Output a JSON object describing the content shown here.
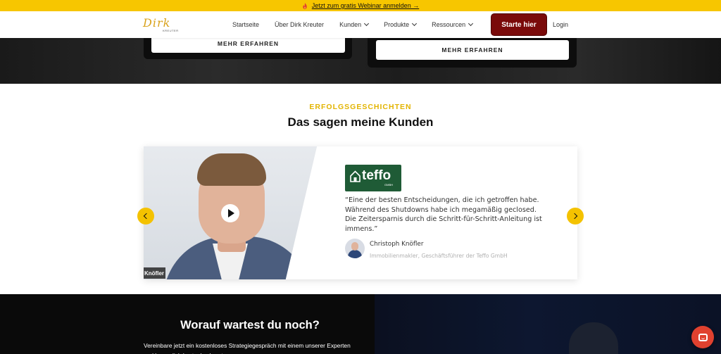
{
  "announcement": {
    "text": "Jetzt zum gratis Webinar anmelden →"
  },
  "header": {
    "logo_text": "Dirk",
    "logo_sub": "KREUTER",
    "nav": [
      {
        "label": "Startseite",
        "dropdown": false
      },
      {
        "label": "Über Dirk Kreuter",
        "dropdown": false
      },
      {
        "label": "Kunden",
        "dropdown": true
      },
      {
        "label": "Produkte",
        "dropdown": true
      },
      {
        "label": "Ressourcen",
        "dropdown": true
      }
    ],
    "cta_label": "Starte hier",
    "login_label": "Login"
  },
  "hero": {
    "buttons": [
      "MEHR ERFAHREN",
      "MEHR ERFAHREN"
    ]
  },
  "testimonials": {
    "eyebrow": "ERFOLGSGESCHICHTEN",
    "heading": "Das sagen meine Kunden",
    "video_nametag": "Knöfler",
    "brand_name": "teffo",
    "brand_suffix": "GMBH",
    "quote": "“Eine der besten Entscheidungen, die ich getroffen habe. Während des Shutdowns habe ich megamäßig geclosed. Die Zeitersparnis durch die Schritt-für-Schritt-Anleitung ist immens.”",
    "author_name": "Christoph Knöfler",
    "author_role": "Immobilienmakler, Geschäftsführer der Teffo GmbH"
  },
  "bottom_cta": {
    "title": "Worauf wartest du noch?",
    "text": "Vereinbare jetzt ein kostenloses Strategiegespräch mit einem unserer Experten und lasse dich kostenlos beraten."
  },
  "colors": {
    "accent_yellow": "#f7c600",
    "cta_red": "#7a0a0a",
    "brand_green": "#1f5b36",
    "chat_red": "#e0412f"
  },
  "icons": {
    "fire": "fire-icon",
    "play": "play-icon",
    "prev": "chevron-left-icon",
    "next": "chevron-right-icon",
    "chat": "chat-icon"
  }
}
